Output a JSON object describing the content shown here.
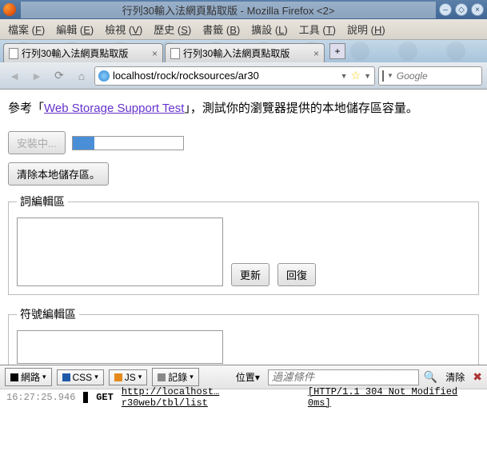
{
  "window": {
    "title": "行列30輸入法網頁點取版 - Mozilla Firefox <2>"
  },
  "menubar": {
    "items": [
      {
        "label": "檔案",
        "key": "F"
      },
      {
        "label": "編輯",
        "key": "E"
      },
      {
        "label": "檢視",
        "key": "V"
      },
      {
        "label": "歷史",
        "key": "S"
      },
      {
        "label": "書籤",
        "key": "B"
      },
      {
        "label": "擴設",
        "key": "L"
      },
      {
        "label": "工具",
        "key": "T"
      },
      {
        "label": "說明",
        "key": "H"
      }
    ]
  },
  "tabs": [
    {
      "label": "行列30輸入法網頁點取版"
    },
    {
      "label": "行列30輸入法網頁點取版"
    }
  ],
  "urlbar": {
    "value": "localhost/rock/rocksources/ar30"
  },
  "searchbox": {
    "placeholder": "Google"
  },
  "page": {
    "intro_prefix": "參考「",
    "intro_link": "Web Storage Support Test",
    "intro_suffix": "」，測試你的瀏覽器提供的本地儲存區容量。",
    "install_btn": "安裝中...",
    "clear_btn": "清除本地儲存區。",
    "section1": {
      "legend": "詞編輯區",
      "update_btn": "更新",
      "restore_btn": "回復"
    },
    "section2": {
      "legend": "符號編輯區"
    }
  },
  "devtools": {
    "btn_net": "網路",
    "btn_css": "CSS",
    "btn_js": "JS",
    "btn_log": "記錄",
    "btn_pos": "位置",
    "filter_placeholder": "過濾條件",
    "clear": "清除"
  },
  "console": {
    "timestamp": "16:27:25.946",
    "method": "GET",
    "url": "http://localhost…r30web/tbl/list",
    "status": "[HTTP/1.1 304 Not Modified 0ms]"
  }
}
